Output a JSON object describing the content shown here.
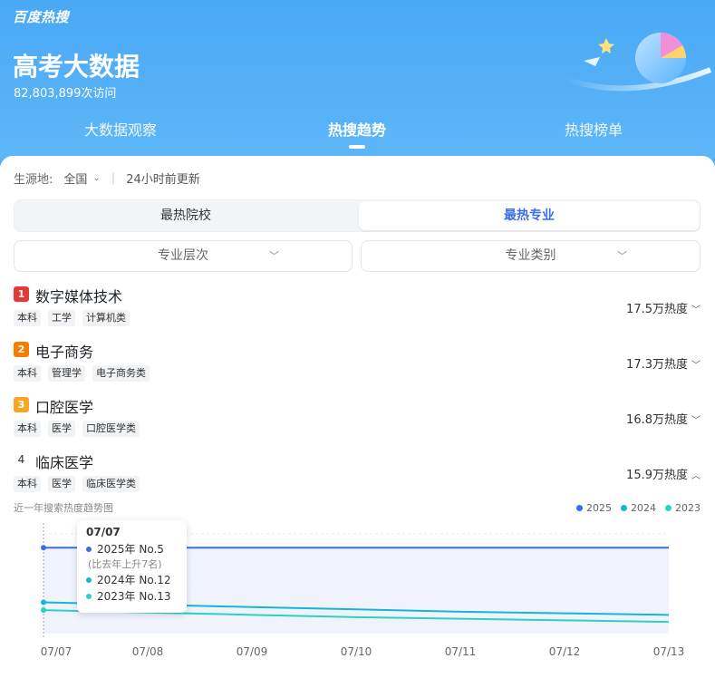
{
  "brand": "百度热搜",
  "hero": {
    "title": "高考大数据",
    "visits": "82,803,899次访问"
  },
  "tabs": [
    {
      "label": "大数据观察"
    },
    {
      "label": "热搜趋势",
      "active": true
    },
    {
      "label": "热搜榜单"
    }
  ],
  "filters": {
    "origin_label": "生源地:",
    "origin_value": "全国",
    "updated": "24小时前更新"
  },
  "segment": {
    "options": [
      "最热院校",
      "最热专业"
    ],
    "selected": "最热专业"
  },
  "dropdowns": {
    "level": "专业层次",
    "category": "专业类别"
  },
  "colors": {
    "accent": "#3b6ee8",
    "rank1": "#e53935",
    "rank2": "#f57c00",
    "rank3": "#f5a623",
    "s2025": "#3a6ee8",
    "s2024": "#13b5d8",
    "s2023": "#2ad3c0"
  },
  "ranking": [
    {
      "rank": "1",
      "name": "数字媒体技术",
      "tags": [
        "本科",
        "工学",
        "计算机类"
      ],
      "heat": "17.5万热度",
      "expanded": false
    },
    {
      "rank": "2",
      "name": "电子商务",
      "tags": [
        "本科",
        "管理学",
        "电子商务类"
      ],
      "heat": "17.3万热度",
      "expanded": false
    },
    {
      "rank": "3",
      "name": "口腔医学",
      "tags": [
        "本科",
        "医学",
        "口腔医学类"
      ],
      "heat": "16.8万热度",
      "expanded": false
    },
    {
      "rank": "4",
      "name": "临床医学",
      "tags": [
        "本科",
        "医学",
        "临床医学类"
      ],
      "heat": "15.9万热度",
      "expanded": true
    }
  ],
  "chart_title": "近一年搜索热度趋势图",
  "chart_data": {
    "type": "line",
    "x": [
      "07/07",
      "07/08",
      "07/09",
      "07/10",
      "07/11",
      "07/12",
      "07/13"
    ],
    "series": [
      {
        "name": "2025",
        "values": [
          5,
          5,
          5,
          5,
          5,
          5,
          5
        ]
      },
      {
        "name": "2024",
        "values": [
          12,
          12.3,
          12.6,
          12.9,
          13.2,
          13.4,
          13.6
        ]
      },
      {
        "name": "2023",
        "values": [
          13,
          13.3,
          13.6,
          13.9,
          14.1,
          14.3,
          14.5
        ]
      }
    ],
    "y_axis": "rank (lower is better)",
    "grid": true,
    "legend": "top-right"
  },
  "tooltip": {
    "date": "07/07",
    "rows": [
      {
        "series": "2025",
        "text": "2025年 No.5",
        "sub": "(比去年上升7名)"
      },
      {
        "series": "2024",
        "text": "2024年 No.12"
      },
      {
        "series": "2023",
        "text": "2023年 No.13"
      }
    ]
  }
}
